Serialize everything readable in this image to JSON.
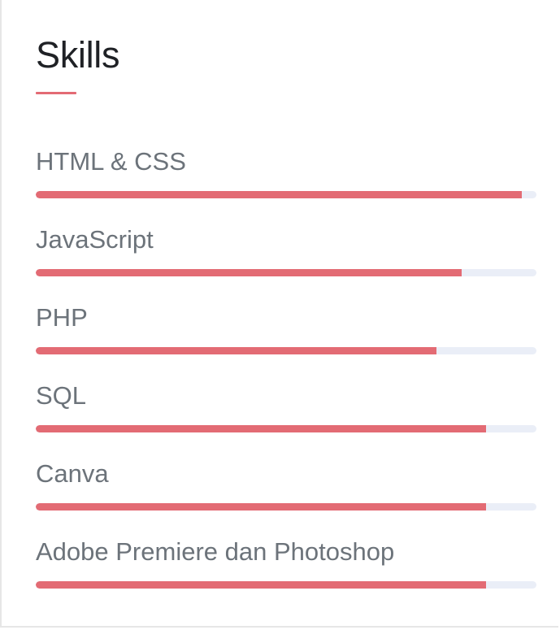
{
  "title": "Skills",
  "accent_color": "#e36b74",
  "track_color": "#eaeef7",
  "skills": [
    {
      "name": "HTML & CSS",
      "level": 97
    },
    {
      "name": "JavaScript",
      "level": 85
    },
    {
      "name": "PHP",
      "level": 80
    },
    {
      "name": "SQL",
      "level": 90
    },
    {
      "name": "Canva",
      "level": 90
    },
    {
      "name": "Adobe Premiere dan Photoshop",
      "level": 90
    }
  ]
}
